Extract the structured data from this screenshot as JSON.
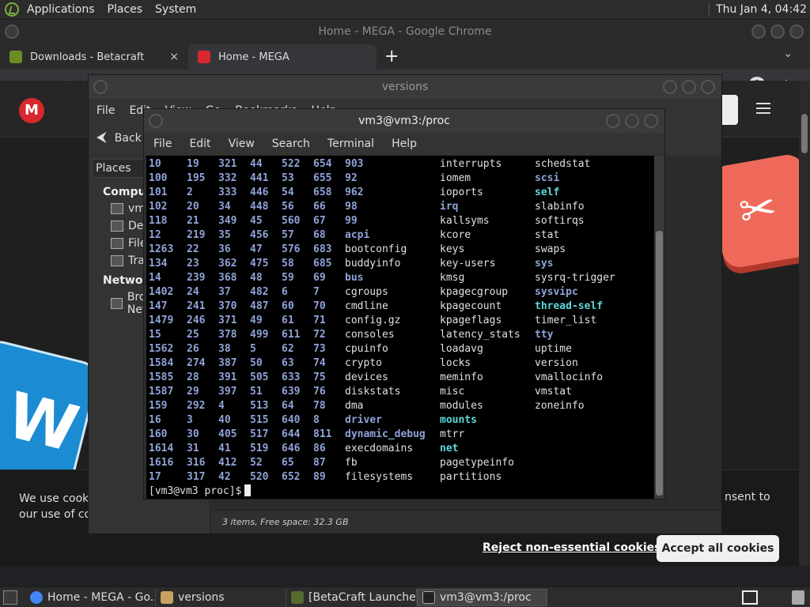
{
  "top_panel": {
    "menus": [
      "Applications",
      "Places",
      "System"
    ],
    "clock": "Thu Jan  4, 04:42"
  },
  "chrome": {
    "window_title": "Home - MEGA - Google Chrome",
    "tabs": [
      {
        "label": "Downloads - Betacraft",
        "close": "×"
      },
      {
        "label": "Home - MEGA",
        "close": "×"
      }
    ],
    "new_tab": "+"
  },
  "mega": {
    "logo": "M",
    "cookie_text": "We use cooki",
    "cookie_text_2": "our use of co",
    "cookie_text_right": "nsent to",
    "reject_label": "Reject non-essential cookies",
    "accept_label": "Accept all cookies",
    "close": "×"
  },
  "nautilus": {
    "title": "versions",
    "menus": [
      "File",
      "Edit",
      "View",
      "Go",
      "Bookmarks",
      "Help"
    ],
    "back_label": "Back",
    "places_header": "Places",
    "sidebar": {
      "computer_header": "Computer",
      "computer_items": [
        "vm3",
        "Desktop",
        "File System",
        "Trash"
      ],
      "network_header": "Network",
      "network_items": [
        "Browse Network"
      ]
    },
    "status": "3 items, Free space: 32.3 GB"
  },
  "terminal": {
    "title": "vm3@vm3:/proc",
    "menus": [
      "File",
      "Edit",
      "View",
      "Search",
      "Terminal",
      "Help"
    ],
    "rows": [
      [
        "10",
        "19",
        "321",
        "44",
        "522",
        "654",
        "903",
        "interrupts",
        "schedstat"
      ],
      [
        "100",
        "195",
        "332",
        "441",
        "53",
        "655",
        "92",
        "iomem",
        "scsi"
      ],
      [
        "101",
        "2",
        "333",
        "446",
        "54",
        "658",
        "962",
        "ioports",
        "self"
      ],
      [
        "102",
        "20",
        "34",
        "448",
        "56",
        "66",
        "98",
        "irq",
        "slabinfo"
      ],
      [
        "118",
        "21",
        "349",
        "45",
        "560",
        "67",
        "99",
        "kallsyms",
        "softirqs"
      ],
      [
        "12",
        "219",
        "35",
        "456",
        "57",
        "68",
        "acpi",
        "kcore",
        "stat"
      ],
      [
        "1263",
        "22",
        "36",
        "47",
        "576",
        "683",
        "bootconfig",
        "keys",
        "swaps"
      ],
      [
        "134",
        "23",
        "362",
        "475",
        "58",
        "685",
        "buddyinfo",
        "key-users",
        "sys"
      ],
      [
        "14",
        "239",
        "368",
        "48",
        "59",
        "69",
        "bus",
        "kmsg",
        "sysrq-trigger"
      ],
      [
        "1402",
        "24",
        "37",
        "482",
        "6",
        "7",
        "cgroups",
        "kpagecgroup",
        "sysvipc"
      ],
      [
        "147",
        "241",
        "370",
        "487",
        "60",
        "70",
        "cmdline",
        "kpagecount",
        "thread-self"
      ],
      [
        "1479",
        "246",
        "371",
        "49",
        "61",
        "71",
        "config.gz",
        "kpageflags",
        "timer_list"
      ],
      [
        "15",
        "25",
        "378",
        "499",
        "611",
        "72",
        "consoles",
        "latency_stats",
        "tty"
      ],
      [
        "1562",
        "26",
        "38",
        "5",
        "62",
        "73",
        "cpuinfo",
        "loadavg",
        "uptime"
      ],
      [
        "1584",
        "274",
        "387",
        "50",
        "63",
        "74",
        "crypto",
        "locks",
        "version"
      ],
      [
        "1585",
        "28",
        "391",
        "505",
        "633",
        "75",
        "devices",
        "meminfo",
        "vmallocinfo"
      ],
      [
        "1587",
        "29",
        "397",
        "51",
        "639",
        "76",
        "diskstats",
        "misc",
        "vmstat"
      ],
      [
        "159",
        "292",
        "4",
        "513",
        "64",
        "78",
        "dma",
        "modules",
        "zoneinfo"
      ],
      [
        "16",
        "3",
        "40",
        "515",
        "640",
        "8",
        "driver",
        "mounts",
        ""
      ],
      [
        "160",
        "30",
        "405",
        "517",
        "644",
        "811",
        "dynamic_debug",
        "mtrr",
        ""
      ],
      [
        "1614",
        "31",
        "41",
        "519",
        "646",
        "86",
        "execdomains",
        "net",
        ""
      ],
      [
        "1616",
        "316",
        "412",
        "52",
        "65",
        "87",
        "fb",
        "pagetypeinfo",
        ""
      ],
      [
        "17",
        "317",
        "42",
        "520",
        "652",
        "89",
        "filesystems",
        "partitions",
        ""
      ]
    ],
    "dir_names": [
      "903",
      "92",
      "962",
      "98",
      "99",
      "acpi",
      "bus",
      "driver",
      "dynamic_debug",
      "irq",
      "scsi",
      "sys",
      "sysvipc",
      "tty"
    ],
    "link_names": [
      "self",
      "thread-self",
      "mounts",
      "net"
    ],
    "prompt": "[vm3@vm3 proc]$"
  },
  "taskbar": {
    "tasks": [
      {
        "label": "Home - MEGA - Go...",
        "active": false,
        "color": "#4285f4"
      },
      {
        "label": "versions",
        "active": false,
        "color": "#c8a060"
      },
      {
        "label": "[BetaCraft Launcher...",
        "active": false,
        "color": "#556b2f"
      },
      {
        "label": "vm3@vm3:/proc",
        "active": true,
        "color": "#222222"
      }
    ]
  }
}
